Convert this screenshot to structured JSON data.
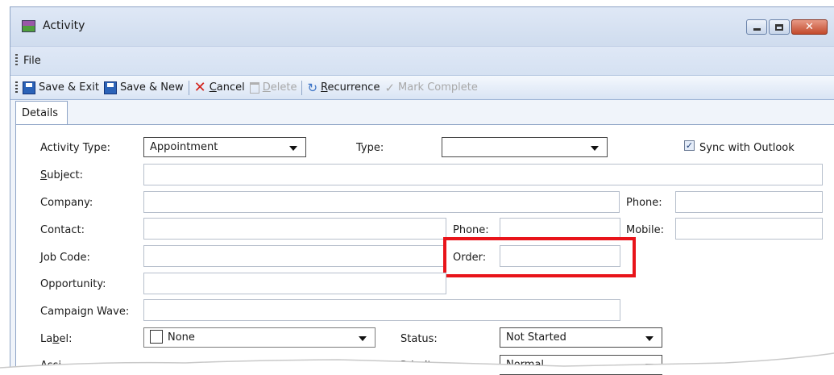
{
  "window": {
    "title": "Activity",
    "close_glyph": "✕"
  },
  "menu": {
    "file": "File"
  },
  "toolbar": {
    "save_exit": "Save & Exit",
    "save_new": "Save & New",
    "cancel_u": "C",
    "cancel_rest": "ancel",
    "delete_u": "D",
    "delete_rest": "elete",
    "recurrence_u": "R",
    "recurrence_rest": "ecurrence",
    "mark_complete": "Mark Complete"
  },
  "tabs": {
    "details": "Details"
  },
  "form": {
    "activity_type_label": "Activity Type:",
    "activity_type_value": "Appointment",
    "type_label": "Type:",
    "type_value": "",
    "sync_label": "Sync with Outlook",
    "sync_checked": true,
    "subject_label_u": "S",
    "subject_label_rest": "ubject:",
    "company_label": "Company:",
    "phone_label": "Phone:",
    "contact_label": "Contact:",
    "contact_phone_label": "Phone:",
    "mobile_label": "Mobile:",
    "job_code_label": "Job Code:",
    "order_label": "Order:",
    "opportunity_label": "Opportunity:",
    "campaign_wave_label": "Campaign Wave:",
    "label_label_pre": "La",
    "label_label_u": "b",
    "label_label_post": "el:",
    "label_value": "None",
    "status_label": "Status:",
    "status_value": "Not Started",
    "assigned_label_partial": "Assi",
    "priority_label": "Priority:",
    "priority_value": "Normal"
  },
  "colors": {
    "highlight": "#e8141a",
    "title_bar": "#dfe8f6",
    "close_button": "#c34a2c"
  }
}
